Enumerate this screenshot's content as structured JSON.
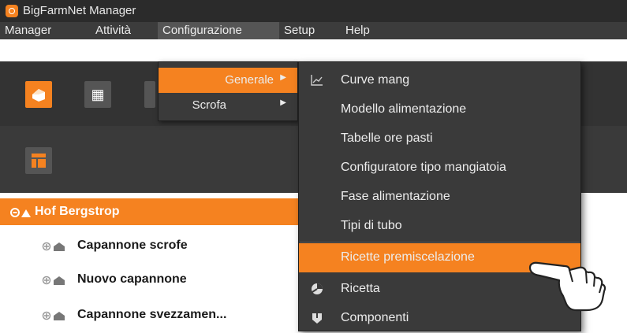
{
  "window": {
    "title": "BigFarmNet Manager"
  },
  "menubar": {
    "items": [
      {
        "label": "Manager"
      },
      {
        "label": "Attività"
      },
      {
        "label": "Configurazione"
      },
      {
        "label": "Setup"
      },
      {
        "label": "Help"
      }
    ]
  },
  "configurazione_menu": {
    "items": [
      {
        "label": "Generale",
        "state": "highlighted"
      },
      {
        "label": "Scrofa"
      }
    ]
  },
  "generale_submenu": {
    "items": [
      {
        "label": "Curve mang",
        "icon": "chart-icon"
      },
      {
        "label": "Modello alimentazione"
      },
      {
        "label": "Tabelle ore pasti"
      },
      {
        "label": "Configuratore tipo mangiatoia"
      },
      {
        "label": "Fase alimentazione"
      },
      {
        "label": "Tipi di tubo"
      },
      {
        "label": "Ricette premiscelazione",
        "state": "highlighted"
      },
      {
        "label": "Ricetta",
        "icon": "recipe-icon"
      },
      {
        "label": "Componenti",
        "icon": "components-icon"
      }
    ]
  },
  "tree": {
    "root": {
      "label": "Hof Bergstrop"
    },
    "nodes": [
      {
        "label": "Capannone scrofe"
      },
      {
        "label": "Nuovo capannone"
      },
      {
        "label": "Capannone svezzamen..."
      }
    ]
  },
  "colors": {
    "accent": "#f58220",
    "menu_bg": "#3a3a3a",
    "titlebar_bg": "#2b2b2b"
  }
}
